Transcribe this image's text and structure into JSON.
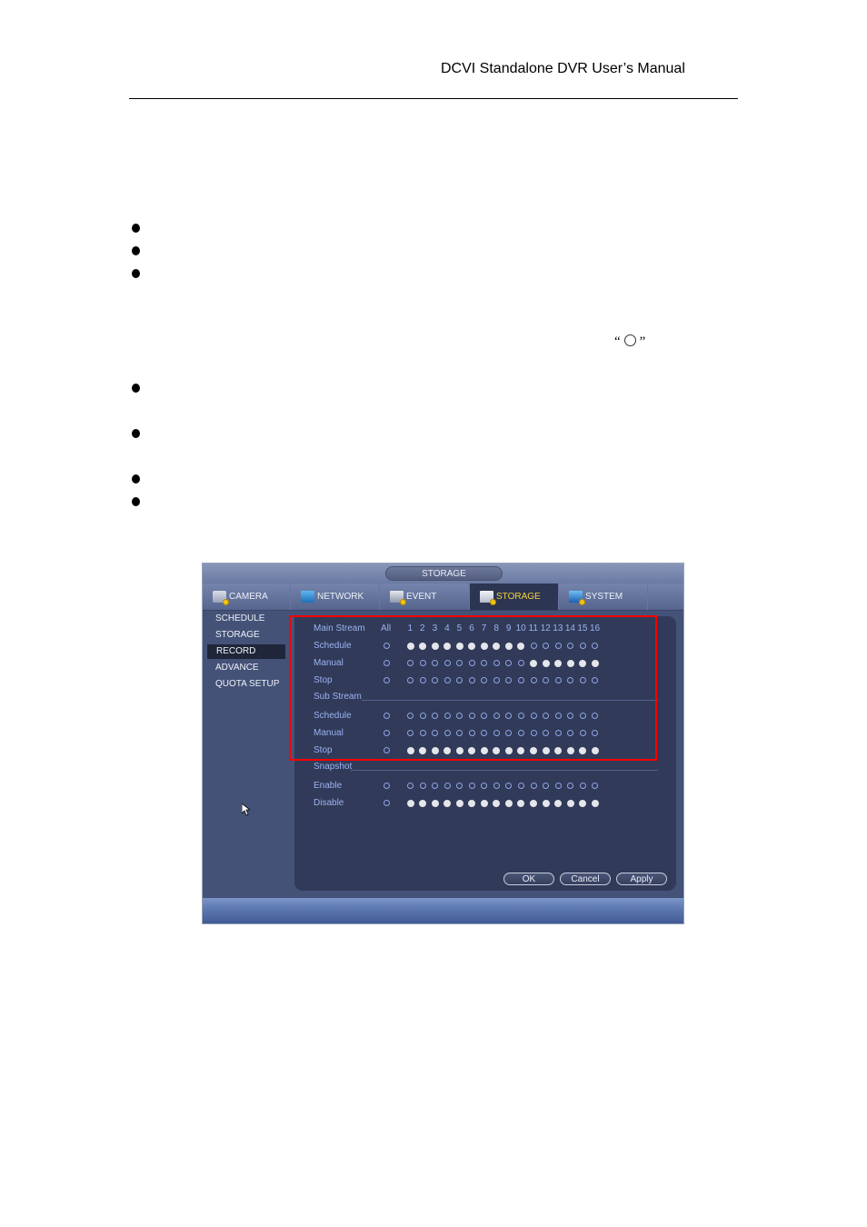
{
  "header": {
    "title": "DCVI Standalone DVR User’s Manual"
  },
  "doc": {
    "inline_symbol": {
      "open_quote": "“",
      "close_quote": "”",
      "symbol": "radio-circle"
    }
  },
  "dvr": {
    "window_title": "STORAGE",
    "tabs": [
      {
        "label": "CAMERA",
        "icon": "camera-icon",
        "active": false
      },
      {
        "label": "NETWORK",
        "icon": "network-icon",
        "active": false
      },
      {
        "label": "EVENT",
        "icon": "event-icon",
        "active": false
      },
      {
        "label": "STORAGE",
        "icon": "storage-icon",
        "active": true
      },
      {
        "label": "SYSTEM",
        "icon": "system-icon",
        "active": false
      }
    ],
    "sidebar": [
      {
        "label": "SCHEDULE",
        "active": false
      },
      {
        "label": "STORAGE",
        "active": false
      },
      {
        "label": "RECORD",
        "active": true
      },
      {
        "label": "ADVANCE",
        "active": false
      },
      {
        "label": "QUOTA SETUP",
        "active": false
      }
    ],
    "record": {
      "main_stream_label": "Main Stream",
      "all_label": "All",
      "channels": [
        "1",
        "2",
        "3",
        "4",
        "5",
        "6",
        "7",
        "8",
        "9",
        "10",
        "11",
        "12",
        "13",
        "14",
        "15",
        "16"
      ],
      "main_rows": [
        {
          "label": "Schedule",
          "all": false,
          "values": [
            1,
            1,
            1,
            1,
            1,
            1,
            1,
            1,
            1,
            1,
            0,
            0,
            0,
            0,
            0,
            0
          ]
        },
        {
          "label": "Manual",
          "all": false,
          "values": [
            0,
            0,
            0,
            0,
            0,
            0,
            0,
            0,
            0,
            0,
            1,
            1,
            1,
            1,
            1,
            1
          ]
        },
        {
          "label": "Stop",
          "all": false,
          "values": [
            0,
            0,
            0,
            0,
            0,
            0,
            0,
            0,
            0,
            0,
            0,
            0,
            0,
            0,
            0,
            0
          ]
        }
      ],
      "sub_stream_label": "Sub Stream",
      "sub_rows": [
        {
          "label": "Schedule",
          "all": false,
          "values": [
            0,
            0,
            0,
            0,
            0,
            0,
            0,
            0,
            0,
            0,
            0,
            0,
            0,
            0,
            0,
            0
          ]
        },
        {
          "label": "Manual",
          "all": false,
          "values": [
            0,
            0,
            0,
            0,
            0,
            0,
            0,
            0,
            0,
            0,
            0,
            0,
            0,
            0,
            0,
            0
          ]
        },
        {
          "label": "Stop",
          "all": false,
          "values": [
            1,
            1,
            1,
            1,
            1,
            1,
            1,
            1,
            1,
            1,
            1,
            1,
            1,
            1,
            1,
            1
          ]
        }
      ],
      "snapshot_label": "Snapshot",
      "snapshot_rows": [
        {
          "label": "Enable",
          "all": false,
          "values": [
            0,
            0,
            0,
            0,
            0,
            0,
            0,
            0,
            0,
            0,
            0,
            0,
            0,
            0,
            0,
            0
          ]
        },
        {
          "label": "Disable",
          "all": false,
          "values": [
            1,
            1,
            1,
            1,
            1,
            1,
            1,
            1,
            1,
            1,
            1,
            1,
            1,
            1,
            1,
            1
          ]
        }
      ]
    },
    "buttons": {
      "ok": "OK",
      "cancel": "Cancel",
      "apply": "Apply"
    },
    "highlight_color": "#ff0000",
    "active_tab_color": "#f2d23a"
  }
}
